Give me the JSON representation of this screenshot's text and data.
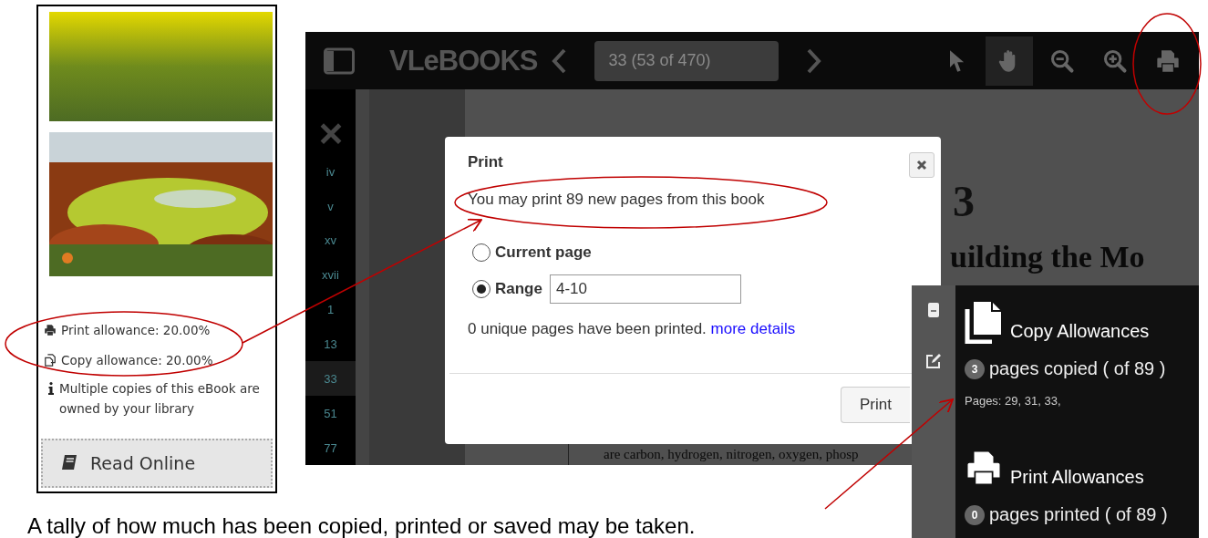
{
  "catalog_card": {
    "allowances": [
      {
        "kind": "print",
        "label": "Print allowance: 20.00%"
      },
      {
        "kind": "copy",
        "label": "Copy allowance: 20.00%"
      }
    ],
    "info": "Multiple copies of this eBook are owned by your library",
    "read_button": "Read Online"
  },
  "reader": {
    "toolbar": {
      "logo": "VLeBOOKS",
      "page_field": "33 (53 of 470)",
      "tools": [
        {
          "kind": "select",
          "selected": false
        },
        {
          "kind": "pan",
          "selected": true
        },
        {
          "kind": "zoom-out",
          "selected": false
        },
        {
          "kind": "zoom-in",
          "selected": false
        },
        {
          "kind": "print",
          "selected": false
        }
      ]
    },
    "thumbnails": [
      {
        "label": "iv",
        "selected": false
      },
      {
        "label": "v",
        "selected": false
      },
      {
        "label": "xv",
        "selected": false
      },
      {
        "label": "xvii",
        "selected": false
      },
      {
        "label": "1",
        "selected": false
      },
      {
        "label": "13",
        "selected": false
      },
      {
        "label": "33",
        "selected": true
      },
      {
        "label": "51",
        "selected": false
      },
      {
        "label": "77",
        "selected": false
      }
    ],
    "page": {
      "chapter_number": "3",
      "heading": "uilding the Mo",
      "body_line": "are carbon, hydrogen, nitrogen, oxygen, phosp"
    },
    "print_dialog": {
      "title": "Print",
      "message": "You may print 89 new pages from this book",
      "options": [
        {
          "label": "Current page",
          "selected": false
        },
        {
          "label": "Range",
          "selected": true,
          "value": "4-10"
        }
      ],
      "status": "0 unique pages have been printed.",
      "link": "more details",
      "button": "Print"
    },
    "allowances_panel": {
      "sections": [
        {
          "kind": "copy",
          "title": "Copy Allowances",
          "count": "3",
          "text": "pages copied ( of 89 )",
          "detail": "Pages: 29, 31, 33,"
        },
        {
          "kind": "print",
          "title": "Print Allowances",
          "count": "0",
          "text": "pages printed ( of 89 )"
        }
      ]
    }
  },
  "caption": "A tally of how much has been copied, printed or saved may be taken."
}
